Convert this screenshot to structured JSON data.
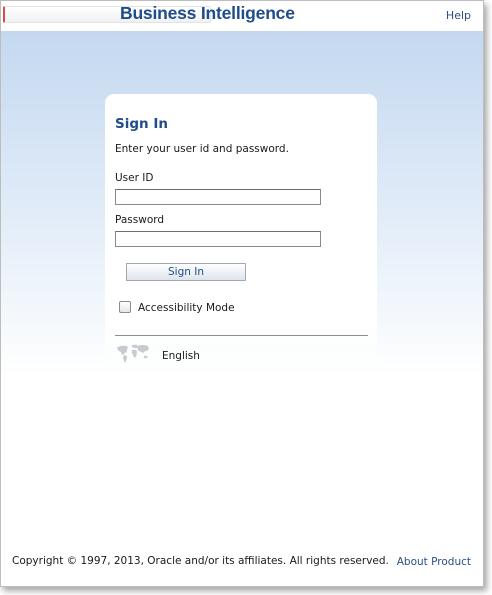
{
  "header": {
    "app_title": "Business Intelligence",
    "help_label": "Help"
  },
  "signin_card": {
    "title": "Sign In",
    "instructions": "Enter your user id and password.",
    "user_id_label": "User ID",
    "user_id_value": "",
    "password_label": "Password",
    "password_value": "",
    "signin_button_label": "Sign In",
    "accessibility_label": "Accessibility Mode",
    "accessibility_checked": false,
    "language": "English"
  },
  "footer": {
    "copyright": "Copyright © 1997, 2013, Oracle and/or its affiliates. All rights reserved.",
    "about_label": "About Product"
  },
  "icons": {
    "globe": "globe-icon",
    "checkbox": "checkbox-icon"
  },
  "colors": {
    "brand_blue": "#1f4d8a",
    "link_blue": "#2a4f86",
    "backdrop_top": "#c4d8f0"
  }
}
